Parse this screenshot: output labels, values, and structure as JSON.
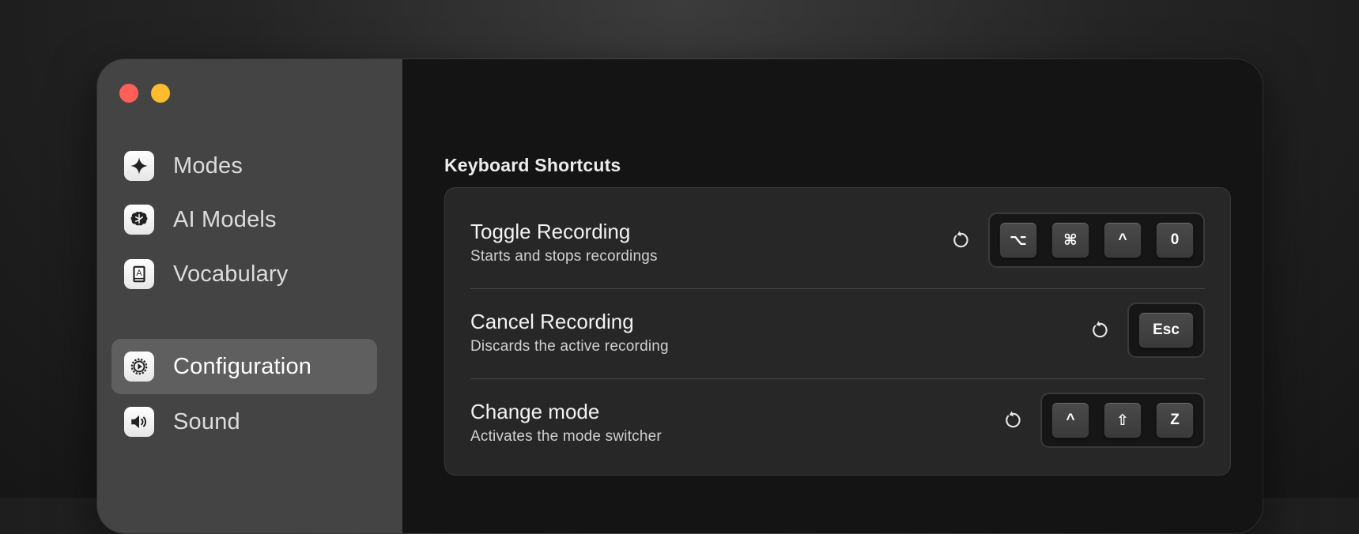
{
  "sidebar": {
    "items": [
      {
        "label": "Modes",
        "icon": "sparkle-icon"
      },
      {
        "label": "AI Models",
        "icon": "brain-icon"
      },
      {
        "label": "Vocabulary",
        "icon": "dictionary-icon"
      },
      {
        "label": "Configuration",
        "icon": "gear-icon",
        "active": true
      },
      {
        "label": "Sound",
        "icon": "speaker-icon"
      }
    ]
  },
  "main": {
    "section_title": "Keyboard Shortcuts",
    "shortcuts": [
      {
        "title": "Toggle Recording",
        "subtitle": "Starts and stops recordings",
        "keys": [
          "⌥",
          "⌘",
          "^",
          "0"
        ]
      },
      {
        "title": "Cancel Recording",
        "subtitle": "Discards the active recording",
        "keys": [
          "Esc"
        ]
      },
      {
        "title": "Change mode",
        "subtitle": "Activates the mode switcher",
        "keys": [
          "^",
          "⇧",
          "Z"
        ]
      }
    ]
  },
  "colors": {
    "close": "#fe5f57",
    "minimize": "#febc2e",
    "sidebar_bg": "#444444",
    "sidebar_active": "#5f5f5f",
    "main_bg": "#141414",
    "card_bg": "#272727"
  }
}
